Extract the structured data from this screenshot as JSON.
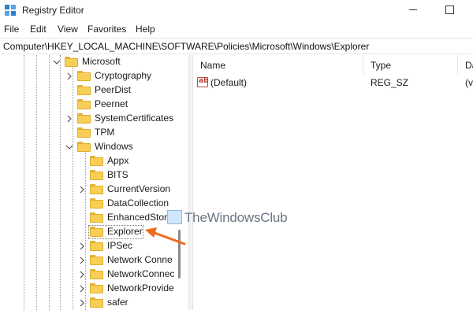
{
  "window": {
    "title": "Registry Editor"
  },
  "menu": [
    "File",
    "Edit",
    "View",
    "Favorites",
    "Help"
  ],
  "address": {
    "path": "Computer\\HKEY_LOCAL_MACHINE\\SOFTWARE\\Policies\\Microsoft\\Windows\\Explorer"
  },
  "tree": [
    {
      "label": "Microsoft",
      "level": 0,
      "expander": "expanded"
    },
    {
      "label": "Cryptography",
      "level": 1,
      "expander": "collapsed"
    },
    {
      "label": "PeerDist",
      "level": 1,
      "expander": "none"
    },
    {
      "label": "Peernet",
      "level": 1,
      "expander": "none"
    },
    {
      "label": "SystemCertificates",
      "level": 1,
      "expander": "collapsed"
    },
    {
      "label": "TPM",
      "level": 1,
      "expander": "none"
    },
    {
      "label": "Windows",
      "level": 1,
      "expander": "expanded"
    },
    {
      "label": "Appx",
      "level": 2,
      "expander": "none"
    },
    {
      "label": "BITS",
      "level": 2,
      "expander": "none"
    },
    {
      "label": "CurrentVersion",
      "level": 2,
      "expander": "collapsed"
    },
    {
      "label": "DataCollection",
      "level": 2,
      "expander": "none"
    },
    {
      "label": "EnhancedStorag",
      "level": 2,
      "expander": "none"
    },
    {
      "label": "Explorer",
      "level": 2,
      "expander": "none",
      "selected": true
    },
    {
      "label": "IPSec",
      "level": 2,
      "expander": "collapsed"
    },
    {
      "label": "Network Conne",
      "level": 2,
      "expander": "collapsed"
    },
    {
      "label": "NetworkConnec",
      "level": 2,
      "expander": "collapsed"
    },
    {
      "label": "NetworkProvide",
      "level": 2,
      "expander": "collapsed"
    },
    {
      "label": "safer",
      "level": 2,
      "expander": "collapsed"
    }
  ],
  "list": {
    "columns": [
      "Name",
      "Type",
      "Da"
    ],
    "rows": [
      {
        "icon": "string-value-icon",
        "icon_text": "ab",
        "name": "(Default)",
        "type": "REG_SZ",
        "data": "(va"
      }
    ]
  },
  "watermark": {
    "text": "TheWindowsClub"
  },
  "annotation": {
    "arrow_color": "#f26b1d",
    "icon": "arrow-pointer-icon"
  },
  "colors": {
    "folder": "#f8cf56",
    "folder_border": "#e0ad2c"
  }
}
